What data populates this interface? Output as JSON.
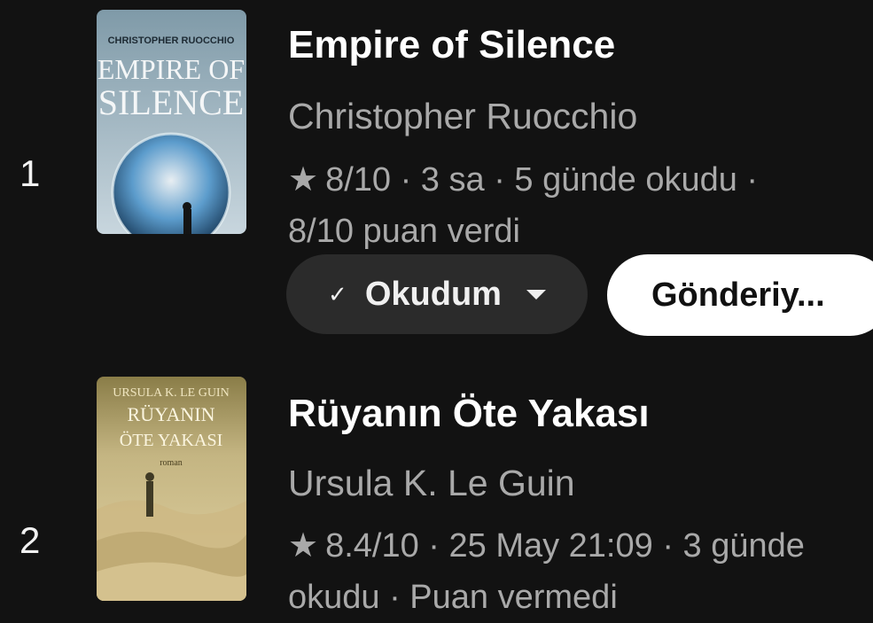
{
  "books": [
    {
      "rank": "1",
      "title": "Empire of Silence",
      "author": "Christopher Ruocchio",
      "meta_line1": "8/10 · 3 sa · 5 günde okudu ·",
      "meta_line2": "8/10 puan verdi",
      "cover_author": "CHRISTOPHER RUOCCHIO",
      "cover_title1": "EMPIRE OF",
      "cover_title2": "SILENCE",
      "status_label": "Okudum",
      "send_label": "Gönderiy..."
    },
    {
      "rank": "2",
      "title": "Rüyanın Öte Yakası",
      "author": "Ursula K. Le Guin",
      "meta_line1": "8.4/10 · 25 May 21:09 · 3 günde",
      "meta_line2": "okudu · Puan vermedi",
      "cover_author": "URSULA K. LE GUIN",
      "cover_title1": "RÜYANIN",
      "cover_title2": "ÖTE YAKASI",
      "cover_sub": "roman"
    }
  ],
  "icons": {
    "rating": "star-icon",
    "status_check": "check-icon",
    "status_dropdown": "caret-down-icon"
  },
  "glyphs": {
    "star": "★",
    "check": "✓"
  },
  "colors": {
    "background": "#121212",
    "title": "#ffffff",
    "secondary_text": "#a9a9a9",
    "status_button": "#2b2b2b",
    "send_button": "#ffffff"
  }
}
